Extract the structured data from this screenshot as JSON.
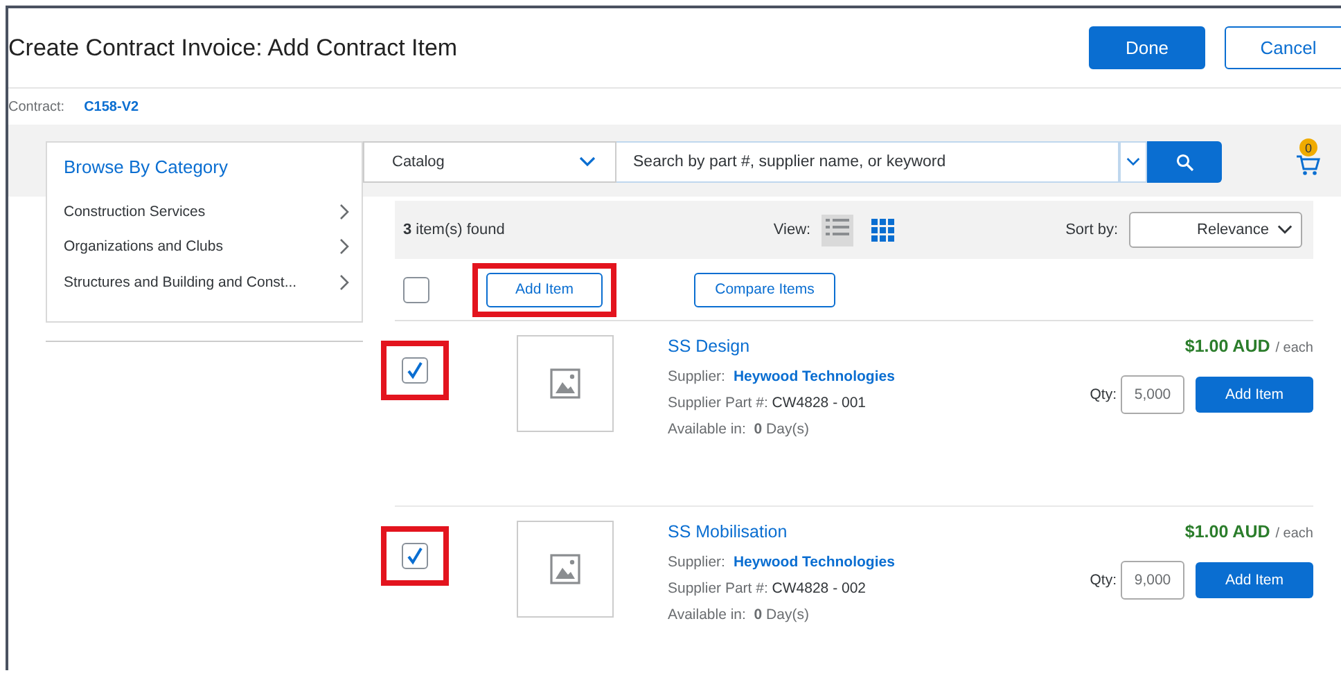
{
  "window": {
    "title": "Create Contract Invoice: Add Contract Item"
  },
  "header_buttons": [
    {
      "label": "Done",
      "kind": "primary"
    },
    {
      "label": "Cancel",
      "kind": "secondary"
    }
  ],
  "contract": {
    "label": "Contract:",
    "value": "C158-V2"
  },
  "sidebar": {
    "title": "Browse By Category",
    "items": [
      "Construction Services",
      "Organizations and Clubs",
      "Structures and Building and Const..."
    ]
  },
  "search": {
    "scope": "Catalog",
    "placeholder": "Search by part #, supplier name, or keyword"
  },
  "cart": {
    "count": "0"
  },
  "results": {
    "count": "**3** item(s) found",
    "view_label": "View:",
    "views": [
      {
        "kind": "list",
        "selected": true
      },
      {
        "kind": "grid",
        "selected": false
      }
    ],
    "sort_label": "Sort by:",
    "sort_value": "Relevance"
  },
  "toolbar": {
    "select_all": {
      "checked": false,
      "highlighted": false
    },
    "add_item": {
      "label": "Add Item",
      "highlighted": true
    },
    "compare": "Compare Items"
  },
  "items": [
    {
      "checked": true,
      "highlighted": true,
      "name": "SS Design",
      "supplier_label": "Supplier:",
      "supplier": "Heywood Technologies",
      "part_label": "Supplier Part #:",
      "part": "CW4828 - 001",
      "available": "Available in:  **0** Day(s)",
      "price": "$1.00 AUD",
      "unit": "/ each",
      "qty_label": "Qty:",
      "qty": "5,000",
      "button": "Add Item"
    },
    {
      "checked": true,
      "highlighted": true,
      "name": "SS Mobilisation",
      "supplier_label": "Supplier:",
      "supplier": "Heywood Technologies",
      "part_label": "Supplier Part #:",
      "part": "CW4828 - 002",
      "available": "Available in:  **0** Day(s)",
      "price": "$1.00 AUD",
      "unit": "/ each",
      "qty_label": "Qty:",
      "qty": "9,000",
      "button": "Add Item"
    }
  ]
}
